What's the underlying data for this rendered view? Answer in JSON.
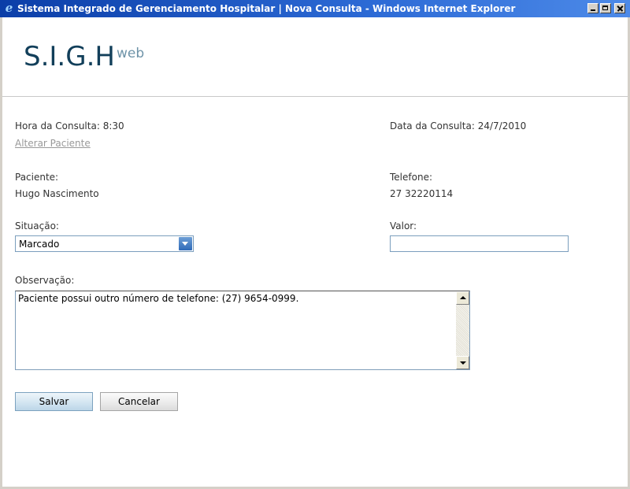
{
  "window": {
    "title": "Sistema Integrado de Gerenciamento Hospitalar | Nova Consulta - Windows Internet Explorer",
    "icon": "ie-icon"
  },
  "logo": {
    "main": "S.I.G.H",
    "sup": "web"
  },
  "consulta": {
    "hora_label": "Hora da Consulta:",
    "hora_value": "8:30",
    "data_label": "Data da Consulta:",
    "data_value": "24/7/2010",
    "alterar_link": "Alterar Paciente"
  },
  "paciente": {
    "label": "Paciente:",
    "value": "Hugo Nascimento"
  },
  "telefone": {
    "label": "Telefone:",
    "value": "27 32220114"
  },
  "situacao": {
    "label": "Situação:",
    "selected": "Marcado"
  },
  "valor": {
    "label": "Valor:",
    "value": ""
  },
  "observacao": {
    "label": "Observação:",
    "value": "Paciente possui outro número de telefone: (27) 9654-0999."
  },
  "buttons": {
    "save": "Salvar",
    "cancel": "Cancelar"
  },
  "colors": {
    "titlebar": "#2d6bd6",
    "logo": "#123f5a",
    "link": "#999999"
  }
}
